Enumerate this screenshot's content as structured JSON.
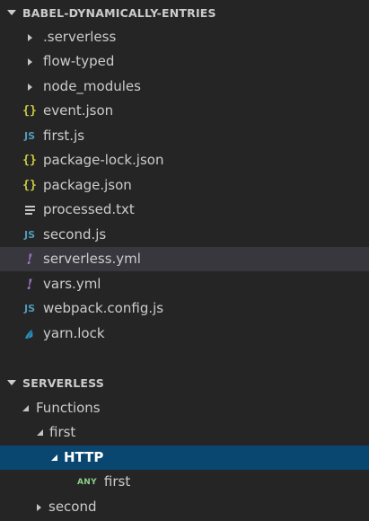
{
  "explorer": {
    "title": "BABEL-DYNAMICALLY-ENTRIES",
    "items": [
      {
        "label": ".serverless",
        "kind": "folder",
        "icon": "chevron-right-icon"
      },
      {
        "label": "flow-typed",
        "kind": "folder",
        "icon": "chevron-right-icon"
      },
      {
        "label": "node_modules",
        "kind": "folder",
        "icon": "chevron-right-icon"
      },
      {
        "label": "event.json",
        "kind": "file",
        "icon": "json-file-icon",
        "glyph": "{}"
      },
      {
        "label": "first.js",
        "kind": "file",
        "icon": "javascript-file-icon",
        "glyph": "JS"
      },
      {
        "label": "package-lock.json",
        "kind": "file",
        "icon": "json-file-icon",
        "glyph": "{}"
      },
      {
        "label": "package.json",
        "kind": "file",
        "icon": "json-file-icon",
        "glyph": "{}"
      },
      {
        "label": "processed.txt",
        "kind": "file",
        "icon": "text-file-icon"
      },
      {
        "label": "second.js",
        "kind": "file",
        "icon": "javascript-file-icon",
        "glyph": "JS"
      },
      {
        "label": "serverless.yml",
        "kind": "file",
        "icon": "yaml-file-icon",
        "glyph": "!"
      },
      {
        "label": "vars.yml",
        "kind": "file",
        "icon": "yaml-file-icon",
        "glyph": "!"
      },
      {
        "label": "webpack.config.js",
        "kind": "file",
        "icon": "javascript-file-icon",
        "glyph": "JS"
      },
      {
        "label": "yarn.lock",
        "kind": "file",
        "icon": "yarn-icon"
      }
    ]
  },
  "serverless": {
    "title": "SERVERLESS",
    "functions_label": "Functions",
    "first_label": "first",
    "http_label": "HTTP",
    "method_badge": "ANY",
    "endpoint_label": "first",
    "second_label": "second"
  },
  "colors": {
    "background": "#252526",
    "selection": "#094771",
    "hover": "#37373d",
    "json": "#cbcb41",
    "js": "#519aba",
    "yml": "#a074c4"
  }
}
